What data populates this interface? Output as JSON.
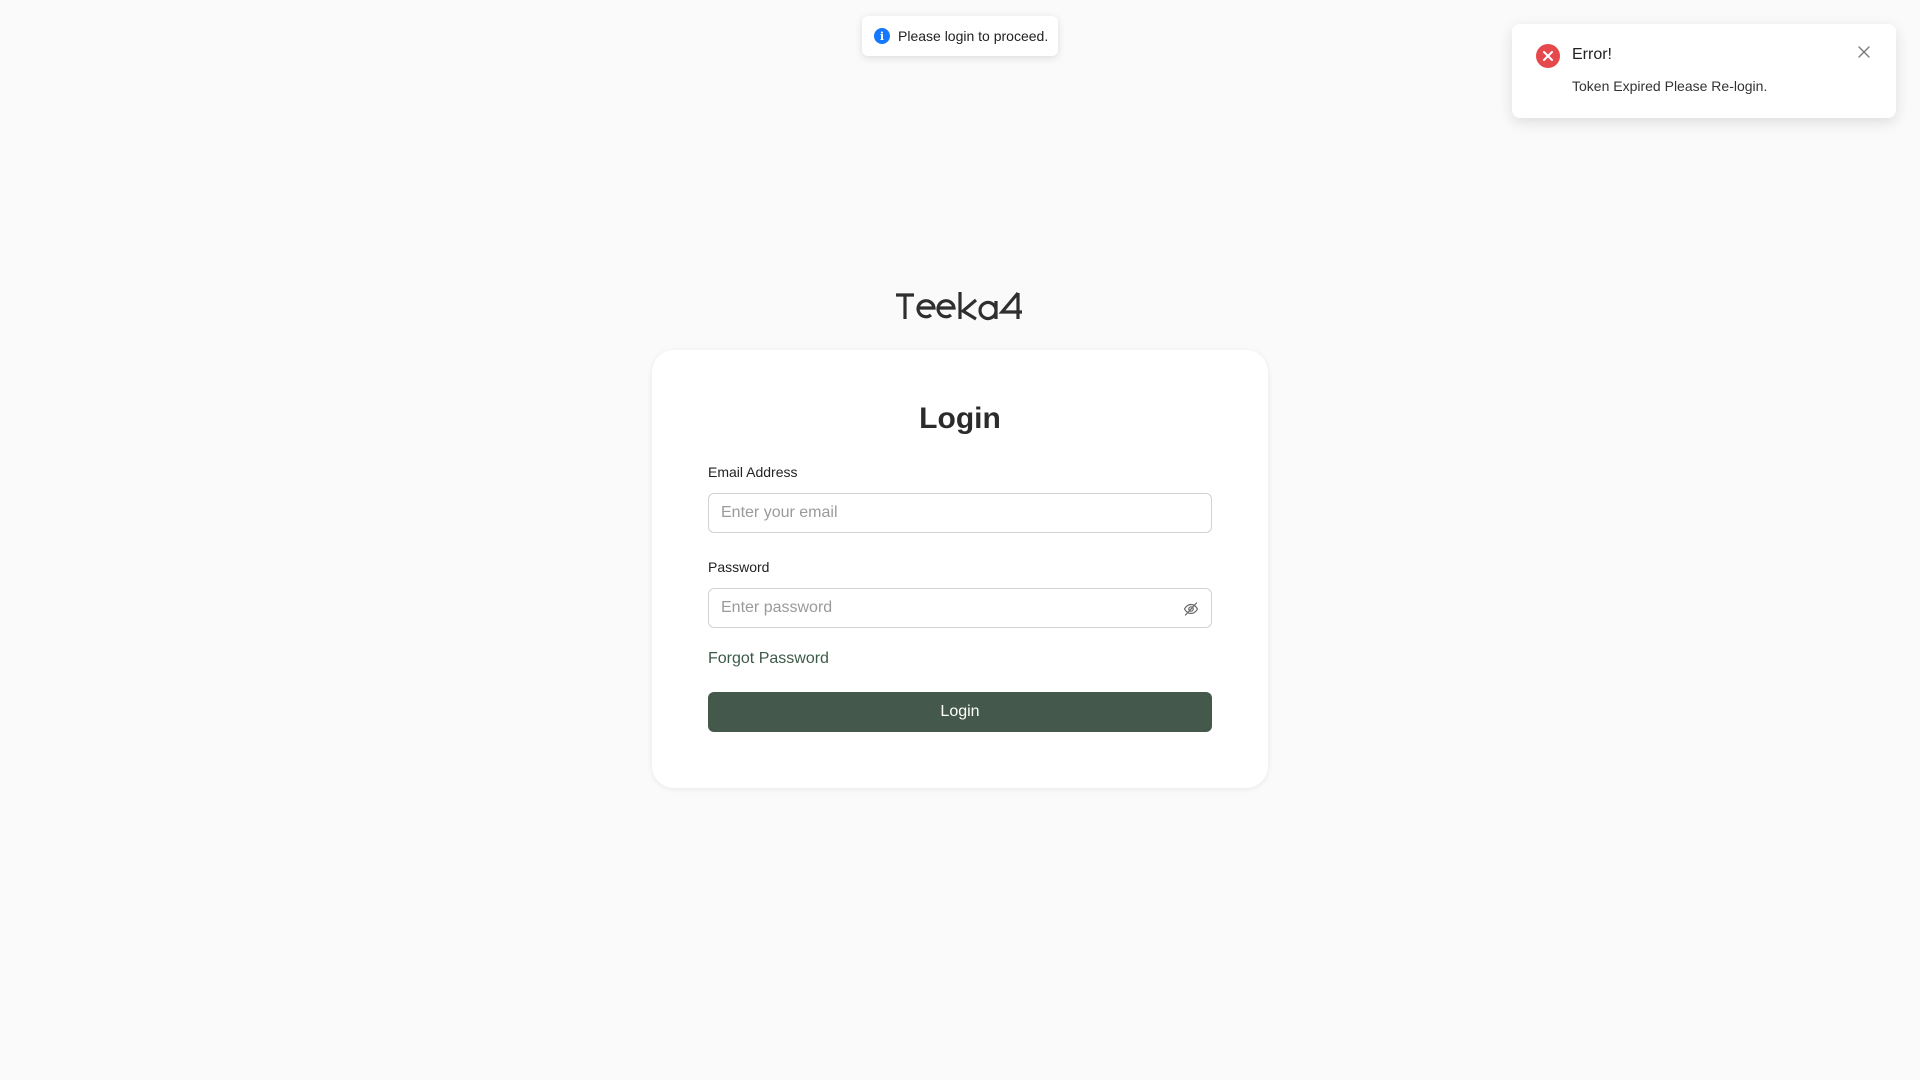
{
  "info_toast": {
    "icon": "info-circle-icon",
    "message": "Please login to proceed.",
    "icon_color": "#1677ff"
  },
  "error_notification": {
    "icon": "error-circle-icon",
    "title": "Error!",
    "message": "Token Expired Please Re-login.",
    "close_icon": "close-icon",
    "icon_color": "#e5484d"
  },
  "logo": {
    "text": "Teeka4"
  },
  "login_form": {
    "title": "Login",
    "email_label": "Email Address",
    "email_value": "",
    "email_placeholder": "Enter your email",
    "password_label": "Password",
    "password_value": "",
    "password_placeholder": "Enter password",
    "password_toggle_icon": "eye-off-icon",
    "forgot_password": "Forgot Password",
    "submit_label": "Login",
    "accent_color": "#44594b"
  }
}
